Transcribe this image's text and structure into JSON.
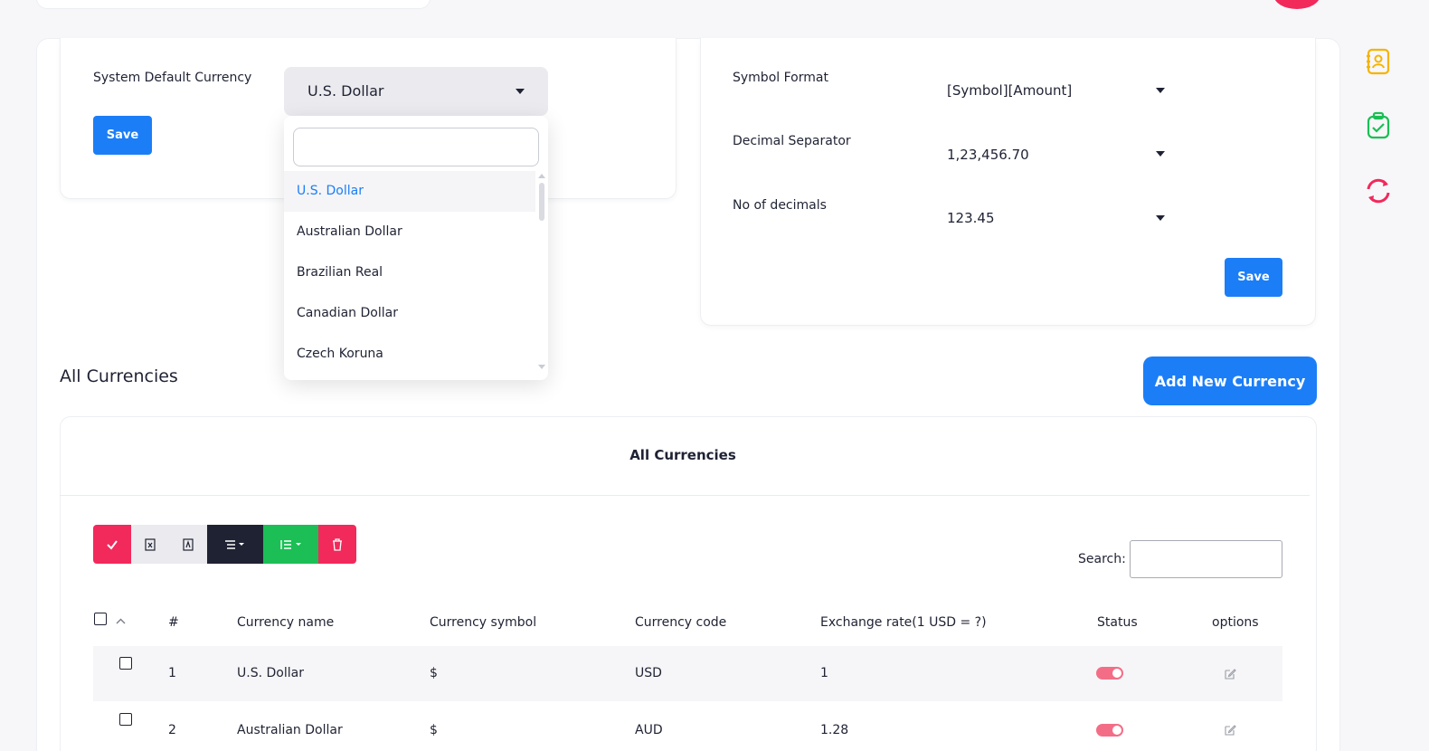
{
  "default_currency": {
    "label": "System Default Currency",
    "selected": "U.S. Dollar",
    "save_label": "Save",
    "dropdown_search_value": "",
    "options": [
      "U.S. Dollar",
      "Australian Dollar",
      "Brazilian Real",
      "Canadian Dollar",
      "Czech Koruna"
    ]
  },
  "format_settings": {
    "symbol_format_label": "Symbol Format",
    "symbol_format_value": "[Symbol][Amount]",
    "decimal_separator_label": "Decimal Separator",
    "decimal_separator_value": "1,23,456.70",
    "no_of_decimals_label": "No of decimals",
    "no_of_decimals_value": "123.45",
    "save_label": "Save"
  },
  "currencies_section": {
    "title": "All Currencies",
    "add_button_label": "Add New Currency",
    "card_title": "All Currencies",
    "search_label": "Search:",
    "search_value": ""
  },
  "toolbar": {
    "buttons": [
      {
        "name": "select-all",
        "icon": "check-icon",
        "color": "#f2295b"
      },
      {
        "name": "export-excel",
        "icon": "excel-file-icon",
        "color": "#ebebef"
      },
      {
        "name": "export-pdf",
        "icon": "pdf-file-icon",
        "color": "#ebebef"
      },
      {
        "name": "columns-menu",
        "icon": "list-icon",
        "color": "#1f2233"
      },
      {
        "name": "sort-menu",
        "icon": "ordered-list-icon",
        "color": "#1bbf55"
      },
      {
        "name": "delete",
        "icon": "trash-icon",
        "color": "#f2295b"
      }
    ]
  },
  "table": {
    "columns": [
      "#",
      "Currency name",
      "Currency symbol",
      "Currency code",
      "Exchange rate(1 USD = ?)",
      "Status",
      "options"
    ],
    "rows": [
      {
        "num": "1",
        "name": "U.S. Dollar",
        "symbol": "$",
        "code": "USD",
        "rate": "1",
        "status": true
      },
      {
        "num": "2",
        "name": "Australian Dollar",
        "symbol": "$",
        "code": "AUD",
        "rate": "1.28",
        "status": true
      }
    ]
  },
  "sidebar_icons": [
    "contact-book-icon",
    "clipboard-check-icon",
    "sync-icon"
  ],
  "colors": {
    "primary": "#1b7ef7",
    "danger": "#f2295b",
    "success": "#1bbf55",
    "warning": "#f5b400"
  }
}
